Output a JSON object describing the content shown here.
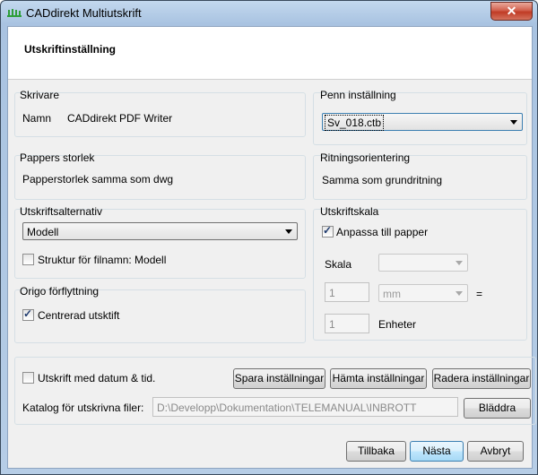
{
  "window": {
    "title": "CADdirekt Multiutskrift",
    "close_label": "✕"
  },
  "header": {
    "title": "Utskriftinställning"
  },
  "skrivare": {
    "label": "Skrivare",
    "name_label": "Namn",
    "name_value": "CADdirekt PDF Writer"
  },
  "penn": {
    "label": "Penn inställning",
    "selected": "Sv_018.ctb"
  },
  "pappers": {
    "label": "Pappers storlek",
    "value": "Papperstorlek samma som dwg"
  },
  "ritning": {
    "label": "Ritningsorientering",
    "value": "Samma som grundritning"
  },
  "alternativ": {
    "label": "Utskriftsalternativ",
    "selected": "Modell",
    "checkbox_label": "Struktur för filnamn: Modell",
    "checkbox_checked": false
  },
  "origo": {
    "label": "Origo förflyttning",
    "checkbox_label": "Centrerad utsktift",
    "checkbox_checked": true
  },
  "skala": {
    "label": "Utskriftskala",
    "fit_label": "Anpassa till papper",
    "fit_checked": true,
    "scale_label": "Skala",
    "scale_value": "",
    "mm_value": "1",
    "mm_unit": "mm",
    "equals": "=",
    "units_value": "1",
    "units_label": "Enheter"
  },
  "bottom": {
    "date_label": "Utskrift med datum & tid.",
    "date_checked": false,
    "save_label": "Spara inställningar",
    "load_label": "Hämta inställningar",
    "delete_label": "Radera inställningar",
    "folder_label": "Katalog för utskrivna filer:",
    "folder_value": "D:\\Developp\\Dokumentation\\TELEMANUAL\\INBROTT",
    "browse_label": "Bläddra"
  },
  "footer": {
    "back_label": "Tillbaka",
    "next_label": "Nästa",
    "cancel_label": "Avbryt"
  },
  "colors": {
    "accent": "#3c7fb1",
    "icon_green": "#2f9e3a",
    "close_red": "#c03b25"
  },
  "icons": {
    "app": "cad-icon",
    "close": "close-icon",
    "dropdown": "chevron-down-icon",
    "check": "checkmark-icon"
  }
}
